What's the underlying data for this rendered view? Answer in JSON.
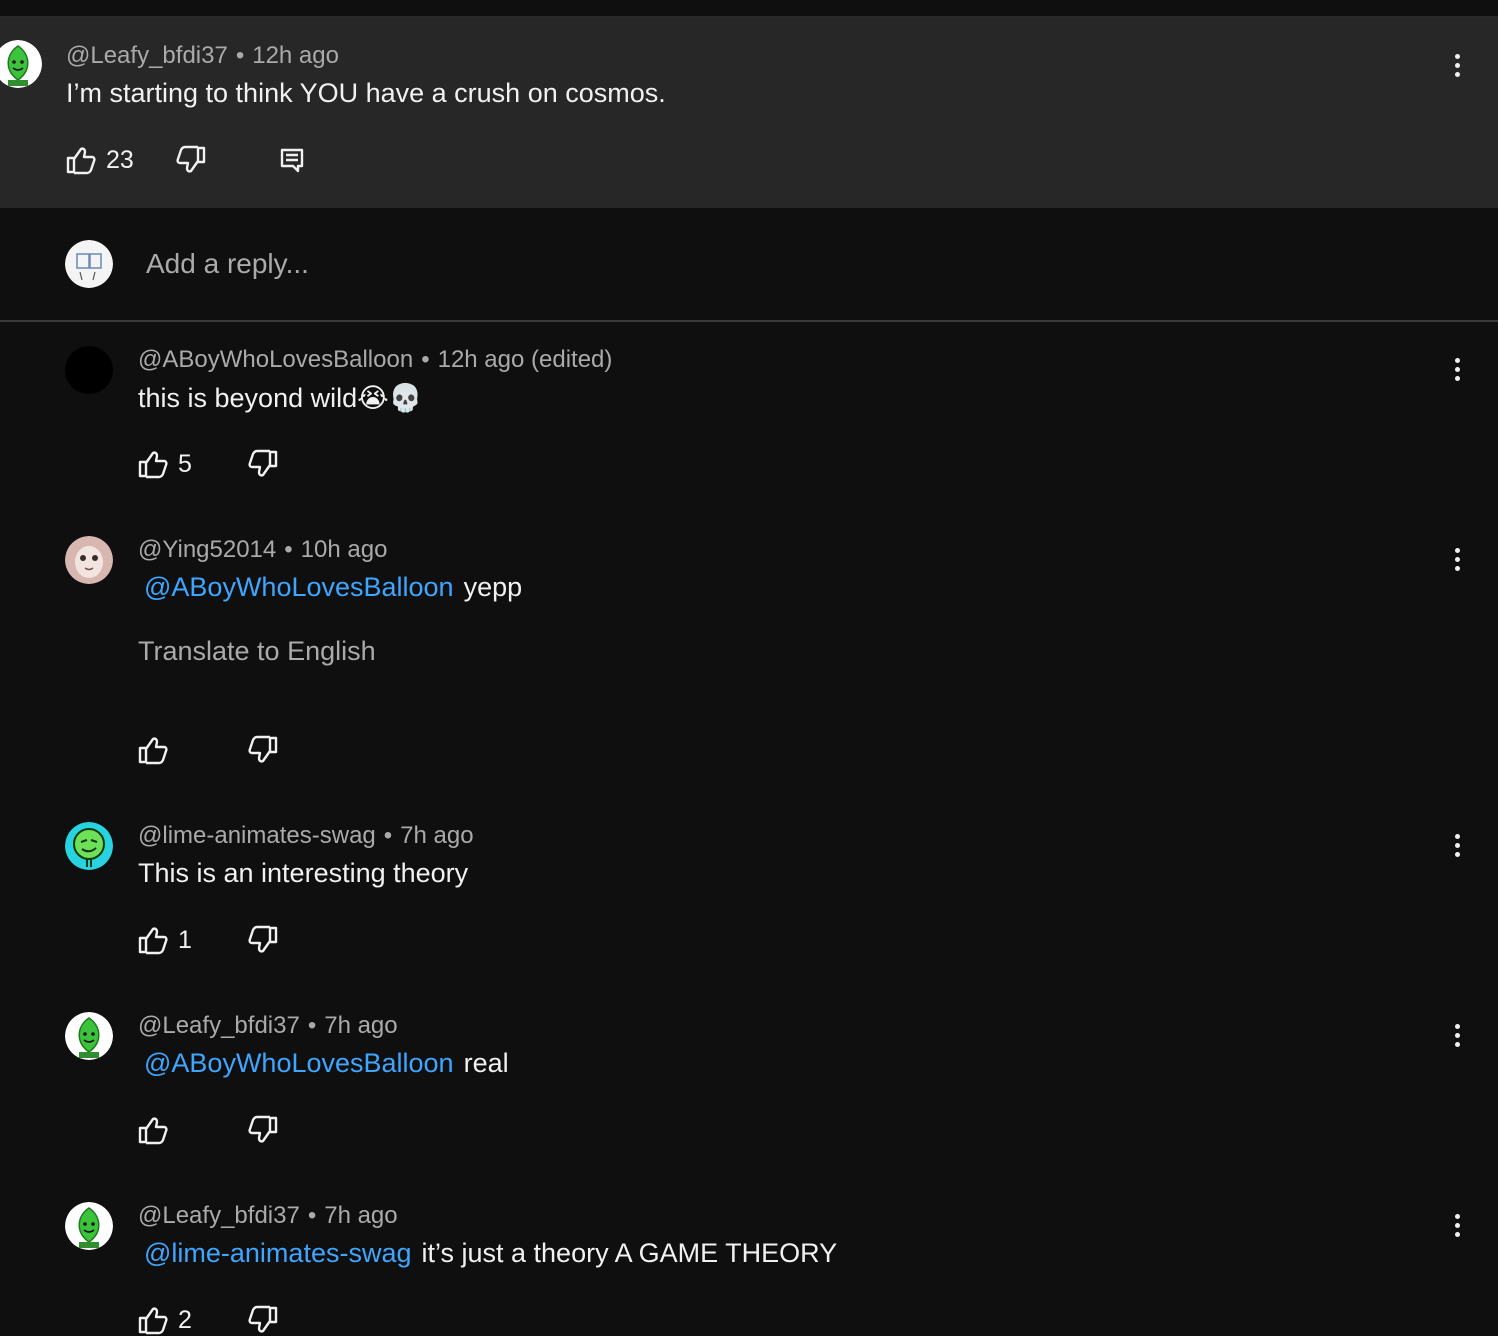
{
  "parent_comment": {
    "author": "@Leafy_bfdi37",
    "time": "12h ago",
    "text": "I’m starting to think YOU have a crush on cosmos.",
    "likes": "23"
  },
  "reply_box": {
    "placeholder": "Add a reply..."
  },
  "replies": [
    {
      "author": "@ABoyWhoLovesBalloon",
      "time": "12h ago (edited)",
      "text": "this is beyond wild😭💀",
      "likes": "5"
    },
    {
      "author": "@Ying52014",
      "time": "10h ago",
      "mention": "@ABoyWhoLovesBalloon",
      "text": "yepp",
      "translate": "Translate to English",
      "likes": ""
    },
    {
      "author": "@lime-animates-swag",
      "time": "7h ago",
      "text": "This is an interesting theory",
      "likes": "1"
    },
    {
      "author": "@Leafy_bfdi37",
      "time": "7h ago",
      "mention": "@ABoyWhoLovesBalloon",
      "text": "real",
      "likes": ""
    },
    {
      "author": "@Leafy_bfdi37",
      "time": "7h ago",
      "mention": "@lime-animates-swag",
      "text": "it’s just a theory A GAME THEORY",
      "likes": "2"
    }
  ],
  "colors": {
    "background": "#0f0f0f",
    "parent_bg": "#272727",
    "mention": "#3ea6ff",
    "meta": "#aaaaaa"
  }
}
